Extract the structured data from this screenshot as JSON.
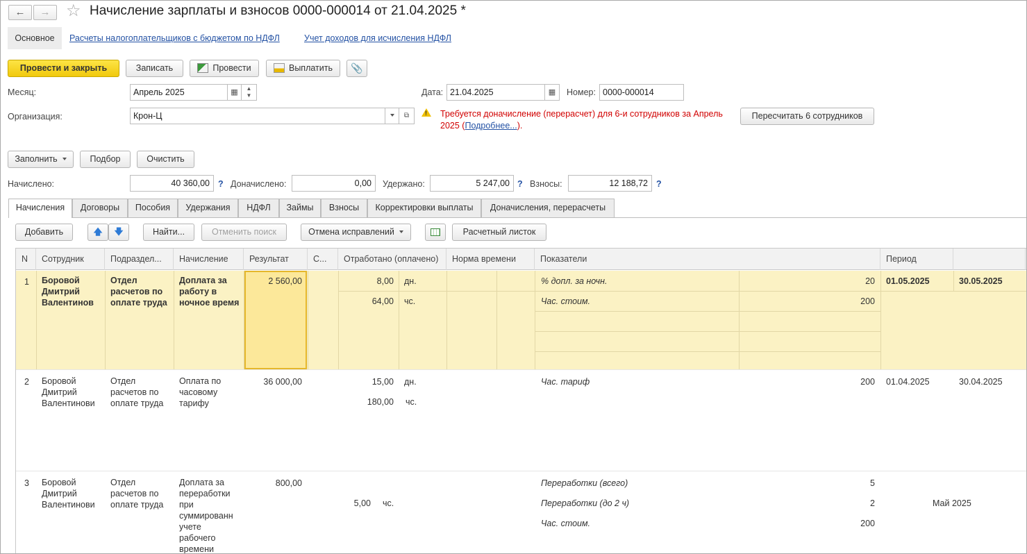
{
  "window": {
    "title": "Начисление зарплаты и взносов 0000-000014 от 21.04.2025 *",
    "back_icon": "arrow-left-icon",
    "forward_icon": "arrow-right-icon",
    "favorite_icon": "star-icon"
  },
  "sections": {
    "active": "Основное",
    "links": [
      "Расчеты налогоплательщиков с бюджетом по НДФЛ",
      "Учет доходов для исчисления НДФЛ"
    ]
  },
  "toolbar": {
    "post_close": "Провести и закрыть",
    "save": "Записать",
    "post": "Провести",
    "pay": "Выплатить",
    "attach_icon": "paperclip-icon"
  },
  "form": {
    "month_label": "Месяц:",
    "month_value": "Апрель 2025",
    "date_label": "Дата:",
    "date_value": "21.04.2025",
    "number_label": "Номер:",
    "number_value": "0000-000014",
    "org_label": "Организация:",
    "org_value": "Крон-Ц",
    "warning_text": "Требуется доначисление (перерасчет) для 6-и сотрудников за Апрель 2025 (",
    "warning_link": "Подробнее...",
    "warning_tail": ").",
    "recalc_button": "Пересчитать 6 сотрудников"
  },
  "fill_toolbar": {
    "fill": "Заполнить",
    "pick": "Подбор",
    "clear": "Очистить"
  },
  "totals": {
    "accrued_label": "Начислено:",
    "accrued_value": "40 360,00",
    "extra_label": "Доначислено:",
    "extra_value": "0,00",
    "withheld_label": "Удержано:",
    "withheld_value": "5 247,00",
    "contrib_label": "Взносы:",
    "contrib_value": "12 188,72",
    "help": "?"
  },
  "tabs": [
    "Начисления",
    "Договоры",
    "Пособия",
    "Удержания",
    "НДФЛ",
    "Займы",
    "Взносы",
    "Корректировки выплаты",
    "Доначисления, перерасчеты"
  ],
  "grid_toolbar": {
    "add": "Добавить",
    "find": "Найти...",
    "cancel_search": "Отменить поиск",
    "undo_fix": "Отмена исправлений",
    "payslip": "Расчетный листок"
  },
  "columns": [
    "N",
    "Сотрудник",
    "Подраздел...",
    "Начисление",
    "Результат",
    "С...",
    "Отработано (оплачено)",
    "Норма времени",
    "Показатели",
    "Период",
    ""
  ],
  "rows": [
    {
      "n": "1",
      "employee": "Боровой Дмитрий Валентинов",
      "dept": "Отдел расчетов по оплате труда",
      "accrual": "Доплата за работу в ночное время",
      "result": "2 560,00",
      "days": "8,00",
      "days_unit": "дн.",
      "hours": "64,00",
      "hours_unit": "чс.",
      "ind1_name": "% допл. за ночн.",
      "ind1_val": "20",
      "ind2_name": "Час. стоим.",
      "ind2_val": "200",
      "period_from": "01.05.2025",
      "period_to": "30.05.2025"
    },
    {
      "n": "2",
      "employee": "Боровой Дмитрий Валентинови",
      "dept": "Отдел расчетов по оплате труда",
      "accrual": "Оплата по часовому тарифу",
      "result": "36 000,00",
      "days": "15,00",
      "days_unit": "дн.",
      "hours": "180,00",
      "hours_unit": "чс.",
      "ind1_name": "Час. тариф",
      "ind1_val": "200",
      "period_from": "01.04.2025",
      "period_to": "30.04.2025"
    },
    {
      "n": "3",
      "employee": "Боровой Дмитрий Валентинови",
      "dept": "Отдел расчетов по оплате труда",
      "accrual": "Доплата за переработки при суммированн учете рабочего времени",
      "result": "800,00",
      "hours": "5,00",
      "hours_unit": "чс.",
      "ind1_name": "Переработки (всего)",
      "ind1_val": "5",
      "ind2_name": "Переработки (до 2 ч)",
      "ind2_val": "2",
      "ind3_name": "Час. стоим.",
      "ind3_val": "200",
      "period_month": "Май 2025"
    }
  ]
}
